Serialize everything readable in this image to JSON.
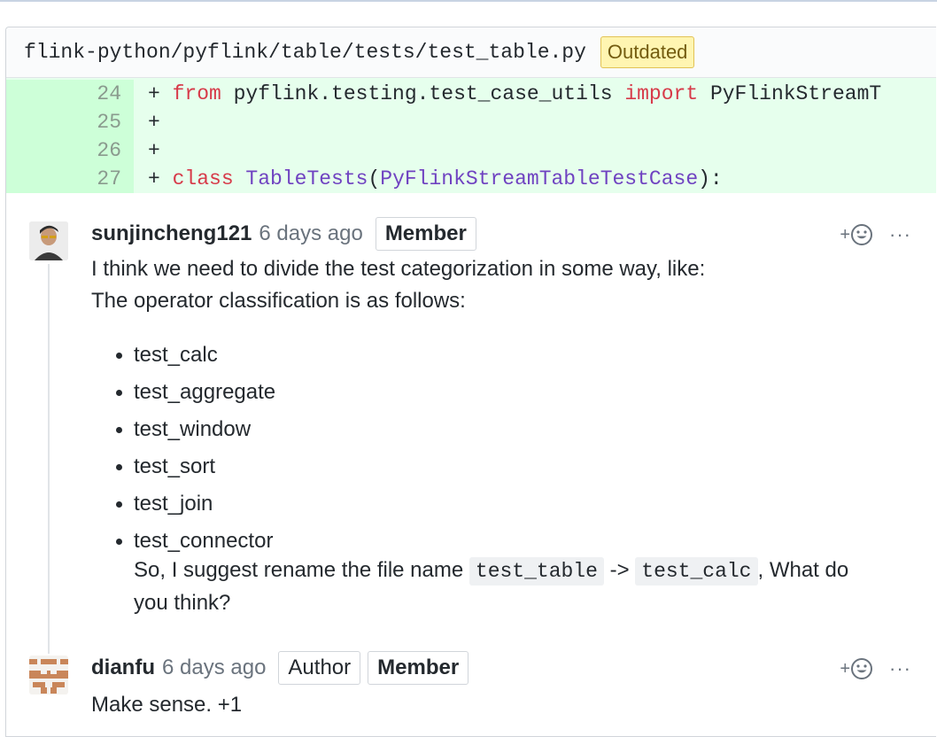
{
  "file": {
    "path": "flink-python/pyflink/table/tests/test_table.py",
    "badge": "Outdated"
  },
  "diff": {
    "lines": [
      {
        "num": "24",
        "prefix": "+ ",
        "kw1": "from",
        "rest1": " pyflink.testing.test_case_utils ",
        "kw2": "import",
        "rest2": " PyFlinkStreamT"
      },
      {
        "num": "25",
        "prefix": "+"
      },
      {
        "num": "26",
        "prefix": "+"
      },
      {
        "num": "27",
        "prefix": "+ ",
        "kw1": "class",
        "cls1": " TableTests",
        "p1": "(",
        "cls2": "PyFlinkStreamTableTestCase",
        "p2": "):"
      }
    ]
  },
  "comments": [
    {
      "author": "sunjincheng121",
      "time": "6 days ago",
      "role": "Member",
      "react_plus": "+",
      "more": "···",
      "text1": "I think we need to divide the test categorization in some way, like:",
      "text2": "The operator classification is as follows:",
      "items": [
        "test_calc",
        "test_aggregate",
        "test_window",
        "test_sort",
        "test_join",
        "test_connector"
      ],
      "suggest_a": "So, I suggest rename the file name ",
      "code_a": "test_table",
      "arrow": " -> ",
      "code_b": "test_calc",
      "suggest_b": ", What do",
      "suggest_c": "you think?"
    },
    {
      "author": "dianfu",
      "time": "6 days ago",
      "role1": "Author",
      "role2": "Member",
      "react_plus": "+",
      "more": "···",
      "text": "Make sense. +1"
    }
  ],
  "colors": {
    "diff_bg": "#e6ffed",
    "gutter_bg": "#cdffd8",
    "keyword": "#d73a49",
    "class_name": "#6f42c1",
    "badge_bg": "#fff5b1"
  }
}
